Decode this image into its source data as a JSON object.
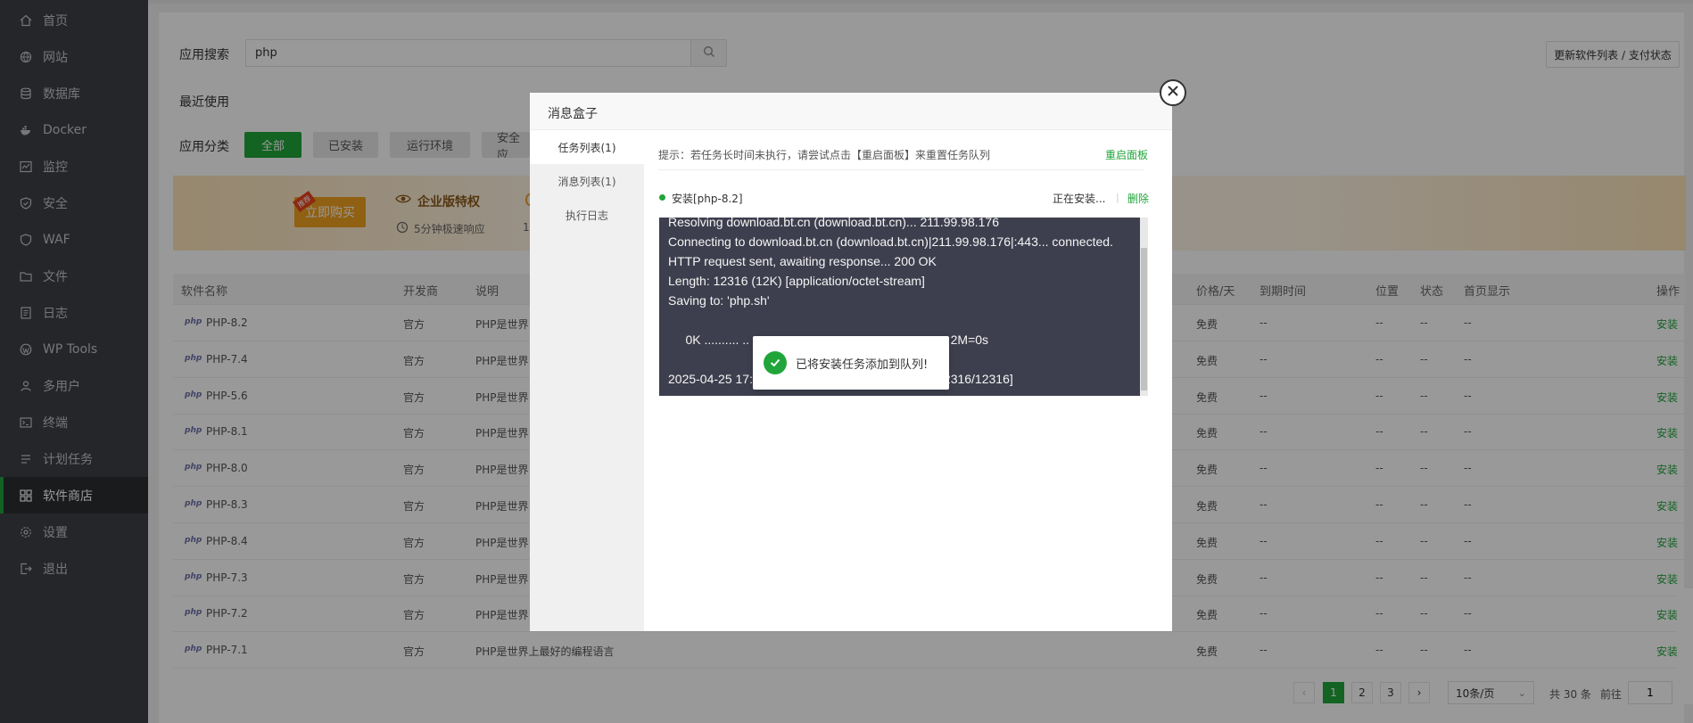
{
  "sidebar": {
    "items": [
      {
        "label": "首页",
        "icon": "home-icon"
      },
      {
        "label": "网站",
        "icon": "globe-icon"
      },
      {
        "label": "数据库",
        "icon": "database-icon"
      },
      {
        "label": "Docker",
        "icon": "docker-icon"
      },
      {
        "label": "监控",
        "icon": "monitor-icon"
      },
      {
        "label": "安全",
        "icon": "shield-icon"
      },
      {
        "label": "WAF",
        "icon": "waf-shield-icon"
      },
      {
        "label": "文件",
        "icon": "folder-icon"
      },
      {
        "label": "日志",
        "icon": "log-icon"
      },
      {
        "label": "WP Tools",
        "icon": "wordpress-icon"
      },
      {
        "label": "多用户",
        "icon": "users-icon"
      },
      {
        "label": "终端",
        "icon": "terminal-icon"
      },
      {
        "label": "计划任务",
        "icon": "cron-icon"
      },
      {
        "label": "软件商店",
        "icon": "apps-icon",
        "active": true
      },
      {
        "label": "设置",
        "icon": "gear-icon"
      },
      {
        "label": "退出",
        "icon": "logout-icon"
      }
    ]
  },
  "search": {
    "label": "应用搜索",
    "value": "php"
  },
  "update_button": "更新软件列表 / 支付状态",
  "recent_label": "最近使用",
  "category": {
    "label": "应用分类",
    "buttons": [
      "全部",
      "已安装",
      "运行环境",
      "安全应"
    ]
  },
  "banner": {
    "buy_label": "立即购买",
    "tag": "推荐",
    "title": "企业版特权",
    "subtitle": "5分钟极速响应",
    "subtitle2": "1"
  },
  "table": {
    "headers": [
      "软件名称",
      "开发商",
      "说明",
      "价格/天",
      "到期时间",
      "位置",
      "状态",
      "首页显示",
      "操作"
    ],
    "rows": [
      {
        "name": "PHP-8.2",
        "dev": "官方",
        "desc": "PHP是世界",
        "price": "免费",
        "expire": "--",
        "loc": "--",
        "status": "--",
        "home": "--",
        "action": "安装"
      },
      {
        "name": "PHP-7.4",
        "dev": "官方",
        "desc": "PHP是世界",
        "price": "免费",
        "expire": "--",
        "loc": "--",
        "status": "--",
        "home": "--",
        "action": "安装"
      },
      {
        "name": "PHP-5.6",
        "dev": "官方",
        "desc": "PHP是世界",
        "price": "免费",
        "expire": "--",
        "loc": "--",
        "status": "--",
        "home": "--",
        "action": "安装"
      },
      {
        "name": "PHP-8.1",
        "dev": "官方",
        "desc": "PHP是世界",
        "price": "免费",
        "expire": "--",
        "loc": "--",
        "status": "--",
        "home": "--",
        "action": "安装"
      },
      {
        "name": "PHP-8.0",
        "dev": "官方",
        "desc": "PHP是世界",
        "price": "免费",
        "expire": "--",
        "loc": "--",
        "status": "--",
        "home": "--",
        "action": "安装"
      },
      {
        "name": "PHP-8.3",
        "dev": "官方",
        "desc": "PHP是世界",
        "price": "免费",
        "expire": "--",
        "loc": "--",
        "status": "--",
        "home": "--",
        "action": "安装"
      },
      {
        "name": "PHP-8.4",
        "dev": "官方",
        "desc": "PHP是世界",
        "price": "免费",
        "expire": "--",
        "loc": "--",
        "status": "--",
        "home": "--",
        "action": "安装"
      },
      {
        "name": "PHP-7.3",
        "dev": "官方",
        "desc": "PHP是世界",
        "price": "免费",
        "expire": "--",
        "loc": "--",
        "status": "--",
        "home": "--",
        "action": "安装"
      },
      {
        "name": "PHP-7.2",
        "dev": "官方",
        "desc": "PHP是世界",
        "price": "免费",
        "expire": "--",
        "loc": "--",
        "status": "--",
        "home": "--",
        "action": "安装"
      },
      {
        "name": "PHP-7.1",
        "dev": "官方",
        "desc": "PHP是世界上最好的编程语言",
        "price": "免费",
        "expire": "--",
        "loc": "--",
        "status": "--",
        "home": "--",
        "action": "安装"
      }
    ],
    "php_logo": "php"
  },
  "pager": {
    "pages": [
      "1",
      "2",
      "3"
    ],
    "per_page": "10条/页",
    "total": "共 30 条",
    "goto_label": "前往",
    "goto_value": "1"
  },
  "modal": {
    "title": "消息盒子",
    "side_items": [
      "任务列表(1)",
      "消息列表(1)",
      "执行日志"
    ],
    "hint": "提示：若任务长时间未执行，请尝试点击【重启面板】来重置任务队列",
    "restart_link": "重启面板",
    "task_name": "安装[php-8.2]",
    "task_status": "正在安装...",
    "task_sep": "|",
    "task_delete": "删除",
    "console_lines": [
      "Resolving download.bt.cn (download.bt.cn)... 211.99.98.176",
      "Connecting to download.bt.cn (download.bt.cn)|211.99.98.176|:443... connected.",
      "HTTP request sent, awaiting response... 200 OK",
      "Length: 12316 (12K) [application/octet-stream]",
      "Saving to: 'php.sh'",
      "",
      "     0K .......... ..                                                          2M=0s",
      "",
      "2025-04-25 17:                                                     12316/12316]"
    ]
  },
  "toast": {
    "text": "已将安装任务添加到队列!"
  },
  "colors": {
    "accent": "#20a53a",
    "sidebar_bg": "#3d4045",
    "console_bg": "#3e3f4e"
  }
}
